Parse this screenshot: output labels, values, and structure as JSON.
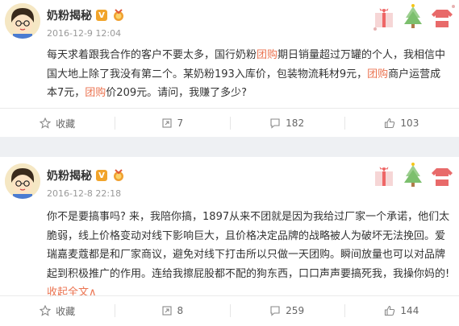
{
  "colors": {
    "highlight": "#eb7350",
    "badge": "#f1a42b",
    "time": "#999999"
  },
  "posts": [
    {
      "author": "奶粉揭秘",
      "verified_badge": "V",
      "time": "2016-12-9 12:04",
      "text": {
        "p1": "每天求着跟我合作的客户不要太多，国行奶粉",
        "h1": "团购",
        "p2": "期日销量超过万罐的个人，我相信中国大地上除了我没有第二个。某奶粉193入库价，包装物流耗材9元，",
        "h2": "团购",
        "p3": "商户运营成本7元，",
        "h3": "团购",
        "p4": "价209元。请问，我赚了多少?"
      },
      "actions": {
        "favorite": "收藏",
        "repost": "7",
        "comment": "182",
        "like": "103"
      }
    },
    {
      "author": "奶粉揭秘",
      "verified_badge": "V",
      "time": "2016-12-8 22:18",
      "text": {
        "p1": "你不是要搞事吗? 来，我陪你搞，1897从来不团就是因为我给过厂家一个承诺，他们太脆弱，线上价格变动对线下影响巨大，且价格决定品牌的战略被人为破坏无法挽回。爱瑞嘉麦蔻都是和厂家商议，避免对线下打击所以只做一天团购。瞬间放量也可以对品牌起到积极推广的作用。连给我擦屁股都不配的狗东西，口口声声要搞死我，我操你妈的!",
        "collapse": "收起全文",
        "collapse_arrow": "∧"
      },
      "actions": {
        "favorite": "收藏",
        "repost": "8",
        "comment": "259",
        "like": "144"
      }
    }
  ]
}
